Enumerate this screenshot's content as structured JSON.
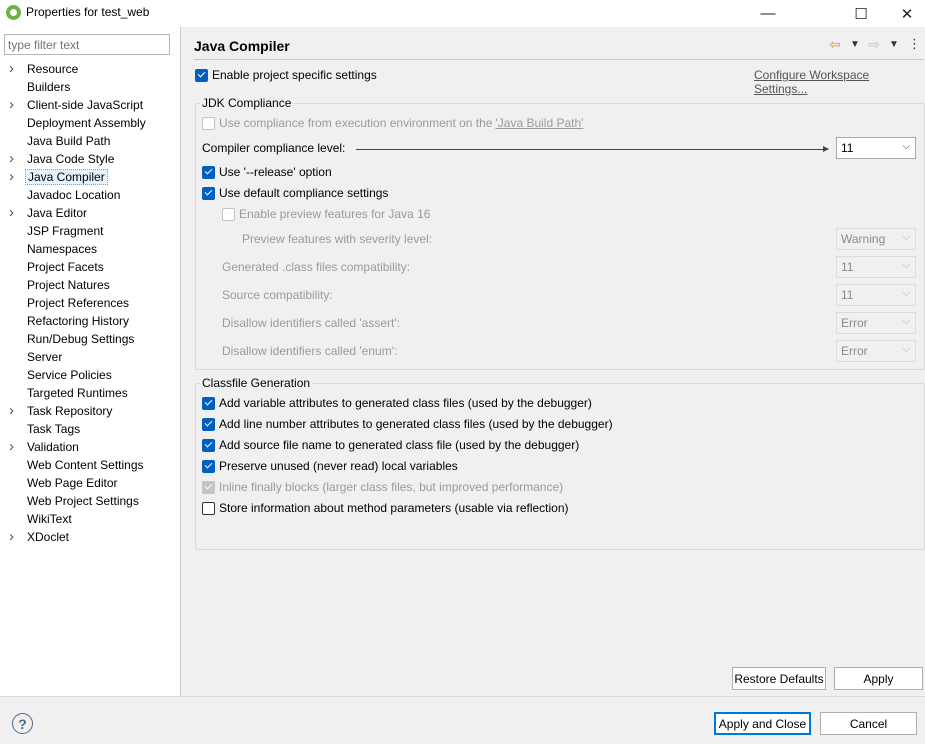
{
  "window": {
    "title": "Properties for test_web",
    "minimize_glyph": "—",
    "maximize_glyph": "☐",
    "close_glyph": "✕"
  },
  "filter": {
    "placeholder": "type filter text"
  },
  "tree": [
    {
      "label": "Resource",
      "expandable": true
    },
    {
      "label": "Builders",
      "expandable": false
    },
    {
      "label": "Client-side JavaScript",
      "expandable": true
    },
    {
      "label": "Deployment Assembly",
      "expandable": false
    },
    {
      "label": "Java Build Path",
      "expandable": false
    },
    {
      "label": "Java Code Style",
      "expandable": true
    },
    {
      "label": "Java Compiler",
      "expandable": true,
      "selected": true
    },
    {
      "label": "Javadoc Location",
      "expandable": false
    },
    {
      "label": "Java Editor",
      "expandable": true
    },
    {
      "label": "JSP Fragment",
      "expandable": false
    },
    {
      "label": "Namespaces",
      "expandable": false
    },
    {
      "label": "Project Facets",
      "expandable": false
    },
    {
      "label": "Project Natures",
      "expandable": false
    },
    {
      "label": "Project References",
      "expandable": false
    },
    {
      "label": "Refactoring History",
      "expandable": false
    },
    {
      "label": "Run/Debug Settings",
      "expandable": false
    },
    {
      "label": "Server",
      "expandable": false
    },
    {
      "label": "Service Policies",
      "expandable": false
    },
    {
      "label": "Targeted Runtimes",
      "expandable": false
    },
    {
      "label": "Task Repository",
      "expandable": true
    },
    {
      "label": "Task Tags",
      "expandable": false
    },
    {
      "label": "Validation",
      "expandable": true
    },
    {
      "label": "Web Content Settings",
      "expandable": false
    },
    {
      "label": "Web Page Editor",
      "expandable": false
    },
    {
      "label": "Web Project Settings",
      "expandable": false
    },
    {
      "label": "WikiText",
      "expandable": false
    },
    {
      "label": "XDoclet",
      "expandable": true
    }
  ],
  "page": {
    "title": "Java Compiler",
    "enable_project_specific": "Enable project specific settings",
    "configure_workspace_link": "Configure Workspace Settings..."
  },
  "jdk": {
    "group_title": "JDK Compliance",
    "use_ee_compliance_prefix": "Use compliance from execution environment on the ",
    "use_ee_compliance_link": "'Java Build Path'",
    "compliance_level_label": "Compiler compliance level:",
    "compliance_level_value": "11",
    "use_release": "Use '--release' option",
    "use_default_compliance": "Use default compliance settings",
    "enable_preview": "Enable preview features for Java 16",
    "preview_severity_label": "Preview features with severity level:",
    "preview_severity_value": "Warning",
    "generated_class_label": "Generated .class files compatibility:",
    "generated_class_value": "11",
    "source_compat_label": "Source compatibility:",
    "source_compat_value": "11",
    "disallow_assert_label": "Disallow identifiers called 'assert':",
    "disallow_assert_value": "Error",
    "disallow_enum_label": "Disallow identifiers called 'enum':",
    "disallow_enum_value": "Error"
  },
  "classfile": {
    "group_title": "Classfile Generation",
    "opt1": "Add variable attributes to generated class files (used by the debugger)",
    "opt2": "Add line number attributes to generated class files (used by the debugger)",
    "opt3": "Add source file name to generated class file (used by the debugger)",
    "opt4": "Preserve unused (never read) local variables",
    "opt5": "Inline finally blocks (larger class files, but improved performance)",
    "opt6": "Store information about method parameters (usable via reflection)"
  },
  "buttons": {
    "restore_defaults": "Restore Defaults",
    "apply": "Apply",
    "apply_and_close": "Apply and Close",
    "cancel": "Cancel",
    "help_glyph": "?"
  },
  "colors": {
    "accent": "#0060c0",
    "selection": "#e5f3ff"
  }
}
